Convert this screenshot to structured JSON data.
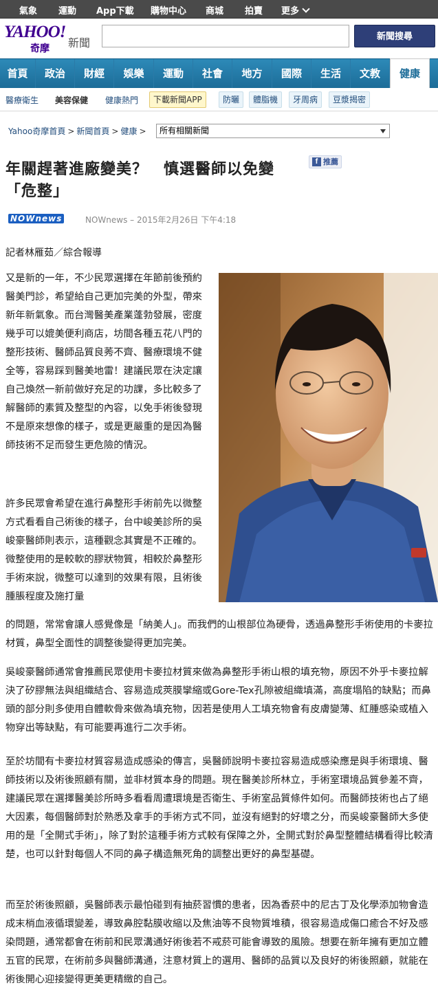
{
  "topbar": {
    "items": [
      "氣象",
      "運動",
      "App下載",
      "購物中心",
      "商城",
      "拍賣",
      "更多"
    ]
  },
  "header": {
    "logo_main": "YAHOO!",
    "logo_sub": "奇摩",
    "logo_section": "新聞",
    "search_button": "新聞搜尋",
    "search_value": ""
  },
  "nav": {
    "tabs": [
      "首頁",
      "政治",
      "財經",
      "娛樂",
      "運動",
      "社會",
      "地方",
      "國際",
      "生活",
      "文教",
      "健康"
    ],
    "active": "健康"
  },
  "subnav": {
    "items": [
      "醫療衛生",
      "美容保健",
      "健康熱門",
      "下載新聞APP",
      "防曬",
      "體脂機",
      "牙周病",
      "豆漿揭密"
    ]
  },
  "breadcrumb": {
    "items": [
      "Yahoo奇摩首頁",
      "新聞首頁",
      "健康"
    ],
    "separator": ">",
    "select_value": "所有相關新聞"
  },
  "article": {
    "title": "年關趕著進廠變美？　慎選醫師以免變「危整」",
    "like_label": "推薦",
    "source_logo": "NOWnews",
    "meta": "NOWnews – 2015年2月26日 下午4:18",
    "reporter": "記者林雁茹／綜合報導",
    "p1": "又是新的一年，不少民眾選擇在年節前後預約醫美門診，希望給自己更加完美的外型，帶來新年新氣象。而台灣醫美產業蓬勃發展，密度幾乎可以媲美便利商店，坊間各種五花八門的整形技術、醫師品質良莠不齊、醫療環境不健全等，容易踩到醫美地雷！建議民眾在決定讓自己煥然一新前做好充足的功課，多比較多了解醫師的素質及整型的內容，以免手術後發現不是原來想像的樣子，或是更嚴重的是因為醫師技術不足而發生更危險的情況。",
    "p2a": "許多民眾會希望在進行鼻整形手術前先以微整方式看看自己術後的樣子，台中峻美診所的吳峻豪醫師則表示，這種觀念其實是不正確的。微整使用的是較軟的膠狀物質，相較於鼻整形手術來說，微整可以達到的效果有限，且術後腫脹程度及施打量",
    "p2b": "的問題，常常會讓人感覺像是「納美人」。而我們的山根部位為硬骨，透過鼻整形手術使用的卡麥拉材質，鼻型全面性的調整後變得更加完美。",
    "p3": "吳峻豪醫師通常會推薦民眾使用卡麥拉材質來做為鼻整形手術山根的填充物，原因不外乎卡麥拉解決了矽膠無法與組織結合、容易造成莢膜攣縮或Gore-Tex孔隙被組織填滿，高度塌陷的缺點；而鼻頭的部分則多使用自體軟骨來做為填充物，因若是使用人工填充物會有皮膚變薄、紅腫感染或植入物穿出等缺點，有可能要再進行二次手術。",
    "p4": "至於坊間有卡麥拉材質容易造成感染的傳言，吳醫師說明卡麥拉容易造成感染應是與手術環境、醫師技術以及術後照顧有關，並非材質本身的問題。現在醫美診所林立，手術室環境品質參差不齊，建議民眾在選擇醫美診所時多看看周遭環境是否衛生、手術室品質條件如何。而醫師技術也占了絕大因素，每個醫師對於熟悉及拿手的手術方式不同，並沒有絕對的好壞之分，而吳峻豪醫師大多使用的是「全開式手術」，除了對於這種手術方式較有保障之外，全開式對於鼻型整體結構看得比較清楚，也可以針對每個人不同的鼻子構造無死角的調整出更好的鼻型基礎。",
    "p5": "而至於術後照顧，吳醫師表示最怕碰到有抽菸習慣的患者，因為香菸中的尼古丁及化學添加物會造成末梢血液循環變差，導致鼻腔黏膜收縮以及焦油等不良物質堆積，很容易造成傷口癒合不好及感染問題，通常都會在術前和民眾溝通好術後若不戒菸可能會導致的風險。想要在新年擁有更加立體五官的民眾，在術前多與醫師溝通，注意材質上的選用、醫師的品質以及良好的術後照顧，就能在術後開心迎接變得更美更精緻的自己。"
  },
  "colors": {
    "nav_blue": "#1c6c98",
    "brand_purple": "#400090",
    "search_btn": "#2e3f78",
    "link": "#224d7c"
  }
}
